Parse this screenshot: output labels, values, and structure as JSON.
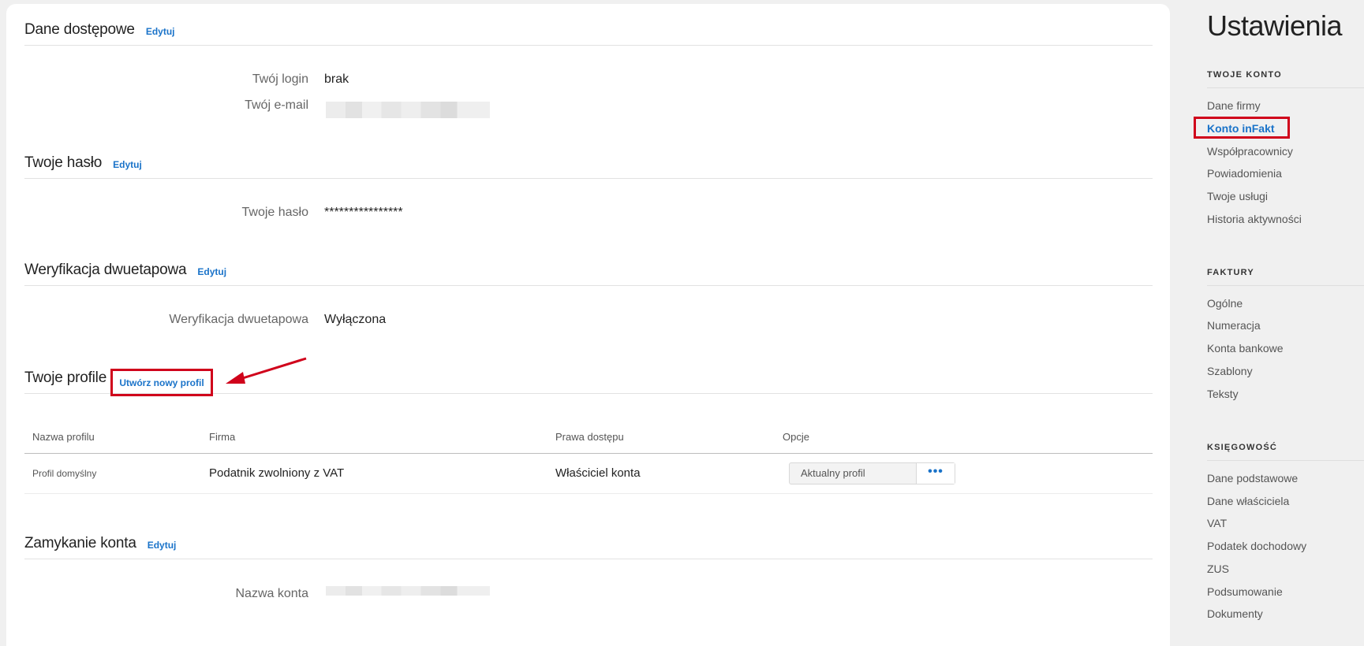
{
  "sections": {
    "access": {
      "title": "Dane dostępowe",
      "edit": "Edytuj"
    },
    "password": {
      "title": "Twoje hasło",
      "edit": "Edytuj"
    },
    "twofa": {
      "title": "Weryfikacja dwuetapowa",
      "edit": "Edytuj"
    },
    "profiles": {
      "title": "Twoje profile",
      "create": "Utwórz nowy profil"
    },
    "close": {
      "title": "Zamykanie konta",
      "edit": "Edytuj"
    }
  },
  "fields": {
    "login_label": "Twój login",
    "login_value": "brak",
    "email_label": "Twój e-mail",
    "password_label": "Twoje hasło",
    "password_value": "****************",
    "twofa_label": "Weryfikacja dwuetapowa",
    "twofa_value": "Wyłączona",
    "account_name_label": "Nazwa konta"
  },
  "table": {
    "headers": [
      "Nazwa profilu",
      "Firma",
      "Prawa dostępu",
      "Opcje"
    ],
    "rows": [
      {
        "name": "Profil domyślny",
        "company": "Podatnik zwolniony z VAT",
        "rights": "Właściciel konta",
        "option": "Aktualny profil",
        "more": "•••"
      }
    ]
  },
  "sidebar": {
    "title": "Ustawienia",
    "groups": [
      {
        "label": "TWOJE KONTO",
        "items": [
          "Dane firmy",
          "Konto inFakt",
          "Współpracownicy",
          "Powiadomienia",
          "Twoje usługi",
          "Historia aktywności"
        ]
      },
      {
        "label": "FAKTURY",
        "items": [
          "Ogólne",
          "Numeracja",
          "Konta bankowe",
          "Szablony",
          "Teksty"
        ]
      },
      {
        "label": "KSIĘGOWOŚĆ",
        "items": [
          "Dane podstawowe",
          "Dane właściciela",
          "VAT",
          "Podatek dochodowy",
          "ZUS",
          "Podsumowanie",
          "Dokumenty"
        ]
      }
    ],
    "active_item": "Konto inFakt"
  },
  "colors": {
    "accent": "#1a73c9",
    "highlight": "#d0021b"
  }
}
